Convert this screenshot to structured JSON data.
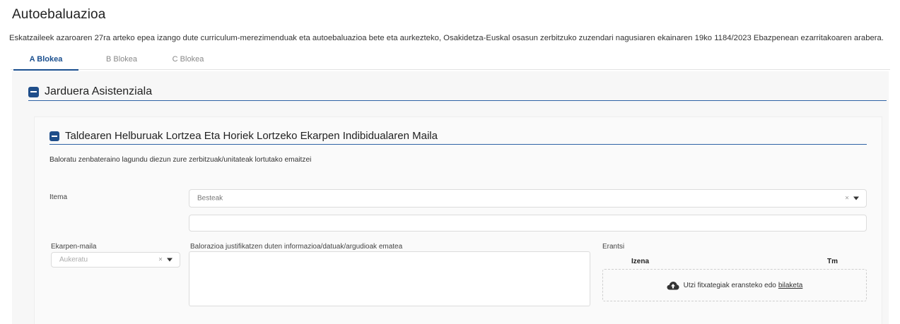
{
  "page": {
    "title": "Autoebaluazioa",
    "description": "Eskatzaileek azaroaren 27ra arteko epea izango dute curriculum-merezimenduak eta autoebaluazioa bete eta aurkezteko, Osakidetza-Euskal osasun zerbitzuko zuzendari nagusiaren ekainaren 19ko 1184/2023 Ebazpenean ezarritakoaren arabera."
  },
  "tabs": [
    {
      "label": "A Blokea",
      "active": true
    },
    {
      "label": "B Blokea",
      "active": false
    },
    {
      "label": "C Blokea",
      "active": false
    }
  ],
  "section": {
    "title": "Jarduera Asistenziala",
    "subsection": {
      "title": "Taldearen Helburuak Lortzea Eta Horiek Lortzeko Ekarpen Indibidualaren Maila",
      "description": "Baloratu zenbateraino lagundu diezun zure zerbitzuak/unitateak lortutako emaitzei"
    }
  },
  "form": {
    "itema_label": "Itema",
    "itema_value": "Besteak",
    "itema_clear": "×",
    "other_value": "",
    "ekarpen_label": "Ekarpen-maila",
    "ekarpen_placeholder": "Aukeratu",
    "ekarpen_clear": "×",
    "justification_label": "Balorazioa justifikatzen duten informazioa/datuak/argudioak ematea",
    "justification_value": "",
    "attach": {
      "label": "Erantsi",
      "col_name": "Izena",
      "col_size": "Tm",
      "drop_text": "Utzi fitxategiak eransteko edo",
      "drop_link": "bilaketa"
    }
  },
  "colors": {
    "accent": "#1f4e8a",
    "active_tab": "#1a4f8f",
    "divider": "#2e62a5"
  },
  "icons": {
    "section_toggle": "minus-square-icon",
    "upload": "cloud-upload-icon",
    "dropdown": "chevron-down-icon",
    "clear": "clear-icon"
  }
}
